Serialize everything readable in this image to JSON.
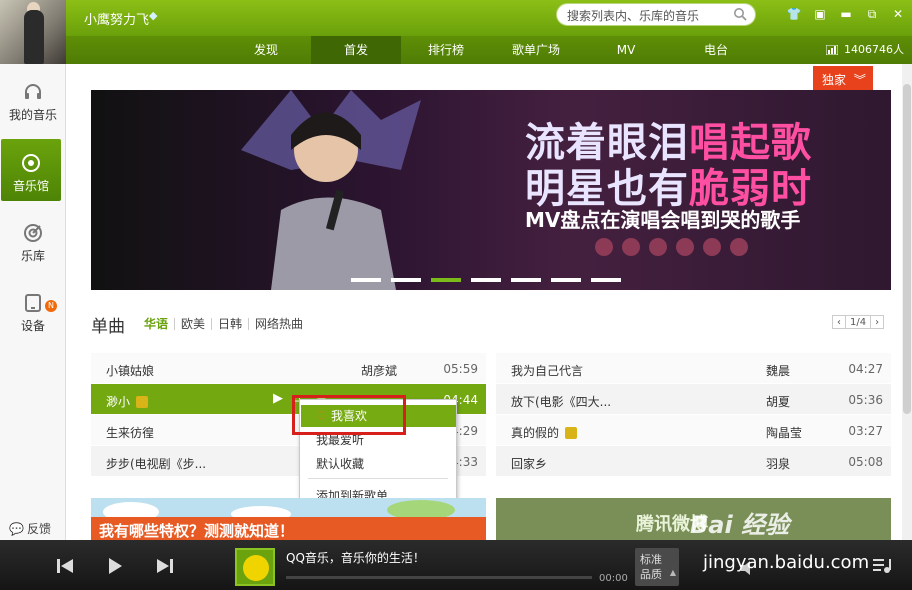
{
  "header": {
    "username": "小鹰努力飞",
    "search_placeholder": "搜索列表内、乐库的音乐",
    "listen_count": "1406746人"
  },
  "nav": {
    "tabs": [
      {
        "label": "发现"
      },
      {
        "label": "首发"
      },
      {
        "label": "排行榜"
      },
      {
        "label": "歌单广场"
      },
      {
        "label": "MV"
      },
      {
        "label": "电台"
      }
    ],
    "active": "首发"
  },
  "sidebar": {
    "items": [
      {
        "label": "我的音乐"
      },
      {
        "label": "音乐馆"
      },
      {
        "label": "乐库"
      },
      {
        "label": "设备"
      }
    ],
    "active": "音乐馆",
    "device_badge": "N",
    "feedback": "反馈"
  },
  "exclusive_button": "独家",
  "banner": {
    "line1_a": "流着眼泪",
    "line1_b": "唱起歌",
    "line2_a": "明星也有",
    "line2_b": "脆弱时",
    "line3": "MV盘点在演唱会唱到哭的歌手",
    "slide_count": 7,
    "active_slide": 3
  },
  "singles": {
    "title": "单曲",
    "tabs": [
      "华语",
      "欧美",
      "日韩",
      "网络热曲"
    ],
    "active_tab": "华语",
    "page": "1/4",
    "left_songs": [
      {
        "name": "小镇姑娘",
        "artist": "胡彦斌",
        "duration": "05:59"
      },
      {
        "name": "渺小",
        "artist": "",
        "duration": "04:44",
        "playing": true,
        "vip": true
      },
      {
        "name": "生来彷徨",
        "artist": "",
        "duration": "04:29"
      },
      {
        "name": "步步(电视剧《步...",
        "artist": "",
        "duration": "04:33"
      }
    ],
    "right_songs": [
      {
        "name": "我为自己代言",
        "artist": "魏晨",
        "duration": "04:27"
      },
      {
        "name": "放下(电影《四大...",
        "artist": "胡夏",
        "duration": "05:36"
      },
      {
        "name": "真的假的",
        "artist": "陶晶莹",
        "duration": "03:27",
        "vip": true
      },
      {
        "name": "回家乡",
        "artist": "羽泉",
        "duration": "05:08"
      }
    ]
  },
  "context_menu": {
    "items": [
      "我喜欢",
      "我最爱听",
      "默认收藏",
      "添加到新歌单"
    ]
  },
  "promos": {
    "left": "我有哪些特权？测测就知道！",
    "right": "腾讯微博"
  },
  "player": {
    "track": "QQ音乐，音乐你的生活！",
    "time": "00:00",
    "quality_line1": "标准",
    "quality_line2": "品质"
  },
  "watermark": {
    "brand": "Bai 经验",
    "url": "jingyan.baidu.com"
  },
  "colors": {
    "brand_green": "#6aa30d",
    "exclusive_red": "#e8421c",
    "highlight_box": "#d7201b"
  }
}
